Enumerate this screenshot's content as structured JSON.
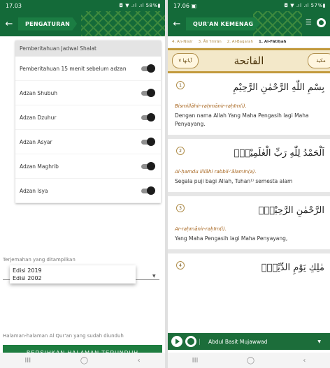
{
  "left": {
    "status_time": "17.03",
    "status_right": "◘ ▼ .ıl .ıl 58%▮",
    "back_arrow": "←",
    "title": "PENGATURAN",
    "card_header": "Pemberitahuan Jadwal Shalat",
    "toggles": [
      {
        "label": "Pemberitahuan 15 menit sebelum adzan"
      },
      {
        "label": "Adzan Shubuh"
      },
      {
        "label": "Adzan Dzuhur"
      },
      {
        "label": "Adzan Asyar"
      },
      {
        "label": "Adzan Maghrib"
      },
      {
        "label": "Adzan Isya"
      }
    ],
    "translation_label": "Terjemahan yang ditampilkan",
    "translation_options": [
      "Edisi 2019",
      "Edisi 2002"
    ],
    "downloaded_label": "Halaman-halaman Al Qur'an yang sudah diunduh",
    "clear_button": "BERSIHKAN HALAMAN TERUNDUH"
  },
  "right": {
    "status_time": "17.06 ▣",
    "status_right": "◘ ▼ .ıl .ıl 57%▮",
    "back_arrow": "←",
    "title": "QUR'AN KEMENAG",
    "tabs": [
      "4. An-Nisā'",
      "3. Āli 'Imrān",
      "2. Al-Baqarah",
      "1. Al-Fātiḥah"
    ],
    "surah_name": "الفاتحة",
    "banner_left": "آياتها ٧",
    "banner_right": "مكية",
    "verses": [
      {
        "num": "1",
        "arabic": "بِسْمِ اللّٰهِ الرَّحْمٰنِ الرَّحِيْمِ",
        "latin": "Bismillāhir-raḥmānir-raḥīm(i).",
        "translation": "Dengan nama Allah Yang Maha Pengasih lagi Maha Penyayang."
      },
      {
        "num": "2",
        "arabic": "اَلْحَمْدُ لِلّٰهِ رَبِّ الْعٰلَمِيْنَۙ",
        "latin": "Al-ḥamdu lillāhi rabbil-'ālamīn(a).",
        "translation": "Segala puji bagi Allah, Tuhan¹⁾ semesta alam"
      },
      {
        "num": "3",
        "arabic": "الرَّحْمٰنِ الرَّحِيْمِۙ",
        "latin": "Ar-raḥmānir-raḥīm(i).",
        "translation": "Yang Maha Pengasih lagi Maha Penyayang,"
      },
      {
        "num": "4",
        "arabic": "مٰلِكِ يَوْمِ الدِّيْنِۗ",
        "latin": "",
        "translation": ""
      }
    ],
    "reciter": "Abdul Basit Mujawwad"
  },
  "navbar": {
    "recent": "III",
    "home": "◯",
    "back": "‹"
  }
}
